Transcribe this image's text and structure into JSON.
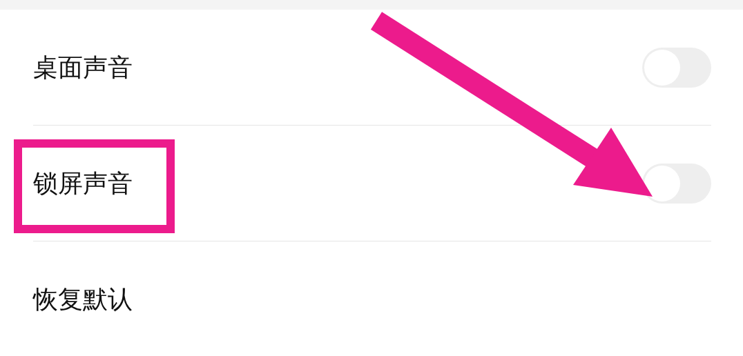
{
  "settings": [
    {
      "label": "桌面声音",
      "kind": "toggle",
      "on": false,
      "highlighted": false
    },
    {
      "label": "锁屏声音",
      "kind": "toggle",
      "on": false,
      "highlighted": true
    },
    {
      "label": "恢复默认",
      "kind": "action",
      "highlighted": false
    }
  ]
}
